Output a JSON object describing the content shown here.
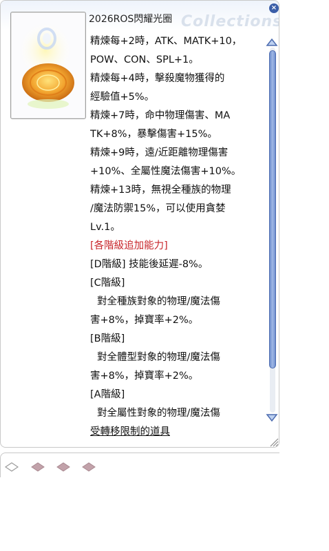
{
  "window": {
    "watermark": "Collections",
    "close_glyph": "×",
    "item_name": "2026ROS閃耀光圈",
    "item_icon": "glowing-halo-icon"
  },
  "description": {
    "lines": [
      "精煉每+2時，ATK、MATK+10，",
      "POW、CON、SPL+1。",
      "精煉每+4時，擊殺魔物獲得的",
      "經驗值+5%。",
      "精煉+7時，命中物理傷害、MA",
      "TK+8%，暴擊傷害+15%。",
      "精煉+9時，遠/近距離物理傷害",
      "+10%、全屬性魔法傷害+10%。",
      "精煉+13時，無視全種族的物理",
      "/魔法防禦15%，可以使用貪婪",
      "Lv.1。"
    ],
    "grade_header": "[各階級追加能力]",
    "grade_lines": [
      "[D階級] 技能後延遲-8%。",
      "[C階級]",
      " 對全種族對象的物理/魔法傷",
      "害+8%，掉寶率+2%。",
      "[B階級]",
      " 對全體型對象的物理/魔法傷",
      "害+8%，掉寶率+2%。",
      "[A階級]",
      " 對全屬性對象的物理/魔法傷"
    ],
    "footer": "受轉移限制的道具"
  },
  "colors": {
    "text": "#111111",
    "grade_header": "#c8262b",
    "scroll_thumb": "#7d9bd6",
    "tab_icon": "#c0a0a8"
  },
  "tabs": [
    {
      "icon": "diamond-outline-icon"
    },
    {
      "icon": "diamond-filled-icon"
    },
    {
      "icon": "diamond-filled-icon"
    },
    {
      "icon": "diamond-filled-icon"
    }
  ]
}
